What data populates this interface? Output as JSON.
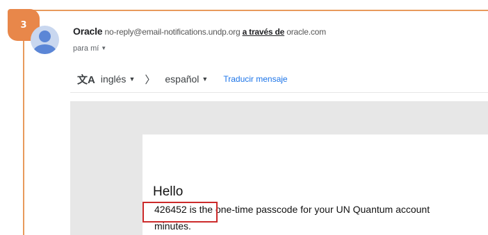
{
  "step": {
    "number": "3"
  },
  "sender": {
    "name": "Oracle",
    "address": "no-reply@email-notifications.undp.org",
    "via_label": "a través de",
    "via_domain": "oracle.com"
  },
  "recipient": {
    "label": "para mí"
  },
  "translate_bar": {
    "icon": "translate-icon",
    "source_language": "inglés",
    "target_language": "español",
    "action_label": "Traducir mensaje"
  },
  "message": {
    "greeting": "Hello",
    "passcode": "426452",
    "passcode_text": " is the one-time passcode for your UN Quantum account",
    "continuation": "minutes."
  },
  "colors": {
    "badge": "#e8874a",
    "frame": "#e89a5c",
    "highlight": "#cc2a2a",
    "link": "#1a73e8"
  }
}
